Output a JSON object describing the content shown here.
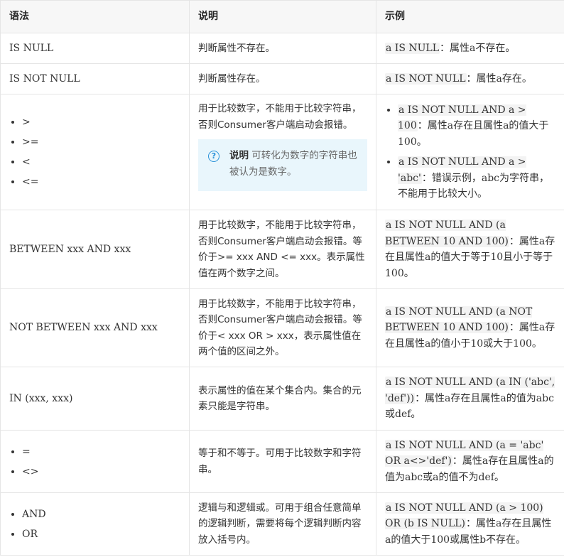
{
  "headers": [
    "语法",
    "说明",
    "示例"
  ],
  "rows": [
    {
      "syntax": "IS NULL",
      "desc": "判断属性不存在。",
      "example_code": "a IS NULL",
      "example_text": "：属性a不存在。"
    },
    {
      "syntax": "IS NOT NULL",
      "desc": "判断属性存在。",
      "example_code": "a IS NOT NULL",
      "example_text": "：属性a存在。"
    },
    {
      "syntax_list": [
        ">",
        ">=",
        "<",
        "<="
      ],
      "desc": "用于比较数字，不能用于比较字符串，否则Consumer客户端启动会报错。",
      "note": {
        "title": "说明",
        "body": "可转化为数字的字符串也被认为是数字。",
        "icon": "question-circle-icon"
      },
      "examples": [
        {
          "code": "a IS NOT NULL AND a > 100",
          "text": "：属性a存在且属性a的值大于100。"
        },
        {
          "code": "a IS NOT NULL AND a > 'abc'",
          "text": "：错误示例，abc为字符串，不能用于比较大小。"
        }
      ]
    },
    {
      "syntax": "BETWEEN xxx AND xxx",
      "desc": "用于比较数字，不能用于比较字符串，否则Consumer客户端启动会报错。等价于>= xxx AND <= xxx。表示属性值在两个数字之间。",
      "example_code": "a IS NOT NULL AND (a BETWEEN 10 AND 100)",
      "example_text": "：属性a存在且属性a的值大于等于10且小于等于100。"
    },
    {
      "syntax": "NOT BETWEEN xxx AND xxx",
      "desc": "用于比较数字，不能用于比较字符串，否则Consumer客户端启动会报错。等价于< xxx OR > xxx，表示属性值在两个值的区间之外。",
      "example_code": "a IS NOT NULL AND (a NOT BETWEEN 10 AND 100)",
      "example_text": "：属性a存在且属性a的值小于10或大于100。"
    },
    {
      "syntax": "IN (xxx, xxx)",
      "desc": "表示属性的值在某个集合内。集合的元素只能是字符串。",
      "example_code": "a IS NOT NULL AND (a IN ('abc', 'def'))",
      "example_text": "：属性a存在且属性a的值为abc或def。"
    },
    {
      "syntax_list": [
        "=",
        "<>"
      ],
      "desc": "等于和不等于。可用于比较数字和字符串。",
      "example_code": "a IS NOT NULL AND (a = 'abc' OR a<>'def')",
      "example_text": "：属性a存在且属性a的值为abc或a的值不为def。"
    },
    {
      "syntax_list": [
        "AND",
        "OR"
      ],
      "desc": "逻辑与和逻辑或。可用于组合任意简单的逻辑判断，需要将每个逻辑判断内容放入括号内。",
      "example_code": "a IS NOT NULL AND (a > 100) OR (b IS NULL)",
      "example_text": "：属性a存在且属性a的值大于100或属性b不存在。"
    }
  ]
}
